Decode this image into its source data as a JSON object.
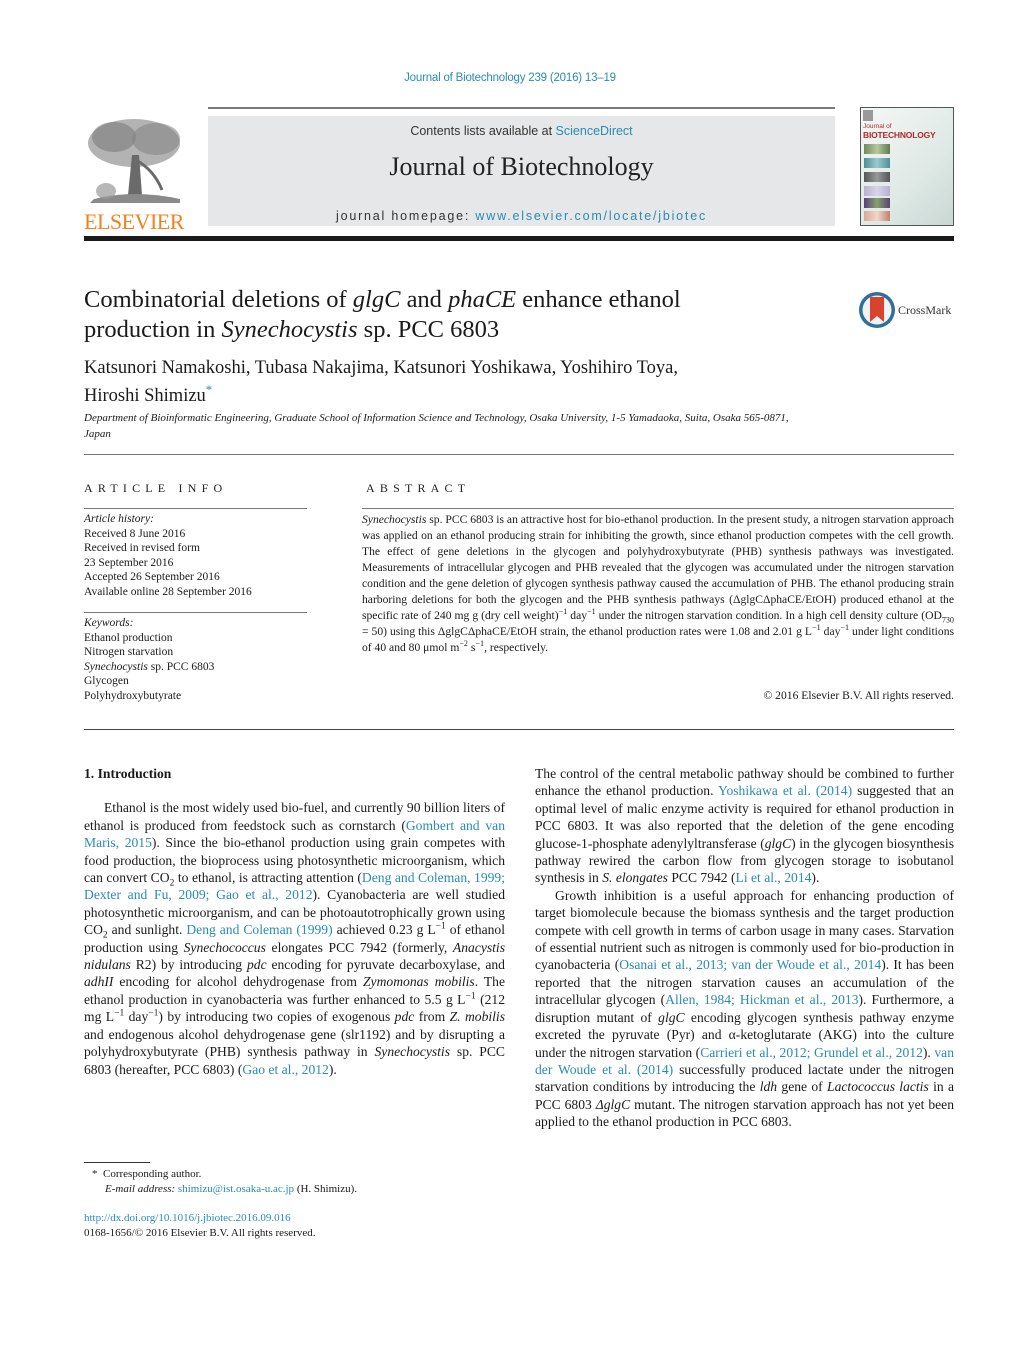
{
  "header": {
    "citation": "Journal of Biotechnology 239 (2016) 13–19",
    "contents_prefix": "Contents lists available at ",
    "contents_link": "ScienceDirect",
    "journal_name": "Journal of Biotechnology",
    "homepage_prefix": "journal homepage: ",
    "homepage_link": "www.elsevier.com/locate/jbiotec",
    "publisher_logo": "ELSEVIER",
    "cover_line1": "Journal of",
    "cover_line2": "BIOTECHNOLOGY",
    "crossmark": "CrossMark",
    "colors": {
      "link": "#2a8bb3",
      "elsevier_orange": "#f0821e",
      "masthead_bg": "#e6e7e8"
    }
  },
  "article": {
    "title_parts": [
      "Combinatorial deletions of ",
      "glgC",
      " and ",
      "phaCE",
      " enhance ethanol",
      "production in ",
      "Synechocystis",
      " sp. PCC 6803"
    ],
    "authors_line1": "Katsunori Namakoshi, Tubasa Nakajima, Katsunori Yoshikawa, Yoshihiro Toya,",
    "authors_line2": "Hiroshi Shimizu",
    "corresponding_mark": "*",
    "affiliation": "Department of Bioinformatic Engineering, Graduate School of Information Science and Technology, Osaka University, 1-5 Yamadaoka, Suita, Osaka 565-0871, Japan"
  },
  "article_info": {
    "heading": "ARTICLE INFO",
    "history_label": "Article history:",
    "history": [
      "Received 8 June 2016",
      "Received in revised form",
      "23 September 2016",
      "Accepted 26 September 2016",
      "Available online 28 September 2016"
    ],
    "keywords_label": "Keywords:",
    "keywords": [
      "Ethanol production",
      "Nitrogen starvation",
      "Synechocystis",
      " sp. PCC 6803",
      "Glycogen",
      "Polyhydroxybutyrate"
    ]
  },
  "abstract": {
    "heading": "ABSTRACT",
    "species": "Synechocystis",
    "text1": " sp. PCC 6803 is an attractive host for bio-ethanol production. In the present study, a nitrogen starvation approach was applied on an ethanol producing strain for inhibiting the growth, since ethanol production competes with the cell growth. The effect of gene deletions in the glycogen and polyhydroxybutyrate (PHB) synthesis pathways was investigated. Measurements of intracellular glycogen and PHB revealed that the glycogen was accumulated under the nitrogen starvation condition and the gene deletion of glycogen synthesis pathway caused the accumulation of PHB. The ethanol producing strain harboring deletions for both the glycogen and the PHB synthesis pathways (ΔglgCΔphaCE/EtOH) produced ethanol at the specific rate of 240 mg g (dry cell weight)",
    "sup1": "−1",
    "text2": " day",
    "sup2": "−1",
    "text3": " under the nitrogen starvation condition. In a high cell density culture (OD",
    "sub1": "730",
    "text4": " = 50) using this ΔglgCΔphaCE/EtOH strain, the ethanol production rates were 1.08 and 2.01 g L",
    "sup3": "−1",
    "text5": " day",
    "sup4": "−1",
    "text6": " under light conditions of 40 and 80 μmol m",
    "sup5": "−2",
    "text7": " s",
    "sup6": "−1",
    "text8": ", respectively.",
    "copyright": "© 2016 Elsevier B.V. All rights reserved."
  },
  "intro": {
    "heading": "1.  Introduction",
    "p1": {
      "a": "Ethanol is the most widely used bio-fuel, and currently 90 billion liters of ethanol is produced from feedstock such as cornstarch (",
      "ref1": "Gombert and van Maris, 2015",
      "b": "). Since the bio-ethanol production using grain competes with food production, the bioprocess using photosynthetic microorganism, which can convert CO",
      "sub_co2": "2",
      "c": " to ethanol, is attracting attention (",
      "ref2": "Deng and Coleman, 1999; Dexter and Fu, 2009; Gao et al., 2012",
      "d": "). Cyanobacteria are well studied photosynthetic microorganism, and can be photoautotrophically grown using CO",
      "e": " and sunlight. ",
      "ref3": "Deng and Coleman (1999)",
      "f": " achieved 0.23 g L",
      "sup_m1": "−1",
      "g": " of ethanol production using ",
      "sp1": "Synechococcus",
      "h": " elongates PCC 7942 (formerly, ",
      "sp2": "Anacystis nidulans",
      "i": " R2) by introducing ",
      "g1": "pdc",
      "j": " encoding for pyruvate decarboxylase, and ",
      "g2": "adhII",
      "k": " encoding for alcohol dehydrogenase from ",
      "sp3": "Zymomonas mobilis",
      "l": ". The ethanol production in cyanobacteria was further enhanced to 5.5 g L",
      "m": " (212 mg L",
      "n": " day",
      "o": ") by introducing two copies of exogenous ",
      "g3": "pdc",
      "p": " from ",
      "sp4": "Z. mobilis",
      "q": " and endogenous alcohol dehydrogenase gene (slr1192) and by disrupting a polyhydroxybutyrate (PHB) synthesis pathway in ",
      "sp5": "Synechocystis",
      "r": " sp. PCC 6803 (hereafter, PCC 6803) (",
      "ref4": "Gao et al., 2012",
      "s": ")."
    },
    "p2": {
      "a": "The control of the central metabolic pathway should be combined to further enhance the ethanol production. ",
      "ref1": "Yoshikawa et al. (2014)",
      "b": " suggested that an optimal level of malic enzyme activity is required for ethanol production in PCC 6803. It was also reported that the deletion of the gene encoding glucose-1-phosphate adenylyltransferase (",
      "g1": "glgC",
      "c": ") in the glycogen biosynthesis pathway rewired the carbon flow from glycogen storage to isobutanol synthesis in ",
      "sp1": "S. elongates",
      "d": " PCC 7942 (",
      "ref2": "Li et al., 2014",
      "e": ")."
    },
    "p3": {
      "a": "Growth inhibition is a useful approach for enhancing production of target biomolecule because the biomass synthesis and the target production compete with cell growth in terms of carbon usage in many cases. Starvation of essential nutrient such as nitrogen is commonly used for bio-production in cyanobacteria (",
      "ref1": "Osanai et al., 2013; van der Woude et al., 2014",
      "b": "). It has been reported that the nitrogen starvation causes an accumulation of the intracellular glycogen (",
      "ref2": "Allen, 1984; Hickman et al., 2013",
      "c": "). Furthermore, a disruption mutant of ",
      "g1": "glgC",
      "d": " encoding glycogen synthesis pathway enzyme excreted the pyruvate (Pyr) and α-ketoglutarate (AKG) into the culture under the nitrogen starvation (",
      "ref3": "Carrieri et al., 2012; Grundel et al., 2012",
      "e": "). ",
      "ref4": "van der Woude et al. (2014)",
      "f": " successfully produced lactate under the nitrogen starvation conditions by introducing the ",
      "g2": "ldh",
      "g": " gene of ",
      "sp1": "Lactococcus lactis",
      "h": " in a PCC 6803 ",
      "g3": "ΔglgC",
      "i": " mutant. The nitrogen starvation approach has not yet been applied to the ethanol production in PCC 6803."
    }
  },
  "footnotes": {
    "mark": "*",
    "corresponding": "Corresponding author.",
    "email_label": "E-mail address:",
    "email": "shimizu@ist.osaka-u.ac.jp",
    "email_suffix": " (H. Shimizu).",
    "doi": "http://dx.doi.org/10.1016/j.jbiotec.2016.09.016",
    "issn_line": "0168-1656/© 2016 Elsevier B.V. All rights reserved."
  }
}
